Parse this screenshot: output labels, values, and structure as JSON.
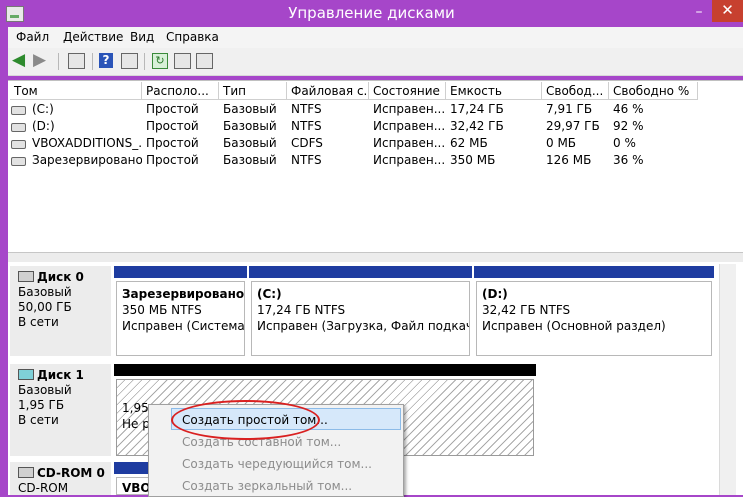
{
  "window": {
    "title": "Управление дисками",
    "minimize": "–",
    "close": "✕"
  },
  "menu": [
    "Файл",
    "Действие",
    "Вид",
    "Справка"
  ],
  "toolbar": {
    "help": "?",
    "refresh": "↻"
  },
  "volume_table": {
    "columns": [
      "Том",
      "Располо...",
      "Тип",
      "Файловая с...",
      "Состояние",
      "Емкость",
      "Свобод...",
      "Свободно %"
    ],
    "rows": [
      [
        "(C:)",
        "Простой",
        "Базовый",
        "NTFS",
        "Исправен...",
        "17,24 ГБ",
        "7,91 ГБ",
        "46 %"
      ],
      [
        "(D:)",
        "Простой",
        "Базовый",
        "NTFS",
        "Исправен...",
        "32,42 ГБ",
        "29,97 ГБ",
        "92 %"
      ],
      [
        "VBOXADDITIONS_...",
        "Простой",
        "Базовый",
        "CDFS",
        "Исправен...",
        "62 МБ",
        "0 МБ",
        "0 %"
      ],
      [
        "Зарезервировано...",
        "Простой",
        "Базовый",
        "NTFS",
        "Исправен...",
        "350 МБ",
        "126 МБ",
        "36 %"
      ]
    ]
  },
  "disks": {
    "disk0": {
      "name": "Диск 0",
      "type": "Базовый",
      "size": "50,00 ГБ",
      "status": "В сети",
      "partitions": [
        {
          "title": "Зарезервировано си",
          "size": "350 МБ NTFS",
          "status": "Исправен (Система, А"
        },
        {
          "title": "(C:)",
          "size": "17,24 ГБ NTFS",
          "status": "Исправен (Загрузка, Файл подкачки, А"
        },
        {
          "title": "(D:)",
          "size": "32,42 ГБ NTFS",
          "status": "Исправен (Основной раздел)"
        }
      ]
    },
    "disk1": {
      "name": "Диск 1",
      "type": "Базовый",
      "size": "1,95 ГБ",
      "status": "В сети",
      "unallocated": {
        "size": "1,95",
        "status": "Не р"
      }
    },
    "cdrom0": {
      "name": "CD-ROM 0",
      "type": "CD-ROM",
      "partition_title": "VBO"
    }
  },
  "context_menu": {
    "items": [
      {
        "label": "Создать простой том...",
        "enabled": true
      },
      {
        "label": "Создать составной том...",
        "enabled": false
      },
      {
        "label": "Создать чередующийся том...",
        "enabled": false
      },
      {
        "label": "Создать зеркальный том...",
        "enabled": false
      }
    ]
  },
  "colors": {
    "title_bar": "#a646c9",
    "partition_header": "#1e3ca0",
    "unallocated_header": "#000000",
    "highlight_ellipse": "#d92020"
  }
}
